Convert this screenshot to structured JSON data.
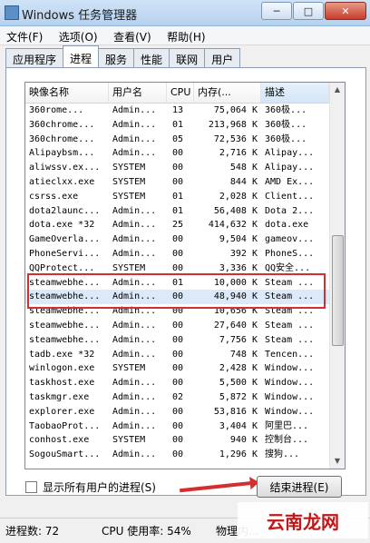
{
  "window": {
    "title": "Windows 任务管理器",
    "minimize": "─",
    "maximize": "□",
    "close": "✕"
  },
  "menu": [
    "文件(F)",
    "选项(O)",
    "查看(V)",
    "帮助(H)"
  ],
  "tabs": [
    "应用程序",
    "进程",
    "服务",
    "性能",
    "联网",
    "用户"
  ],
  "columns": {
    "name": "映像名称",
    "user": "用户名",
    "cpu": "CPU",
    "mem": "内存(...",
    "desc": "描述"
  },
  "processes": [
    {
      "name": "360rome...",
      "user": "Admin...",
      "cpu": "13",
      "mem": "75,064 K",
      "desc": "360极..."
    },
    {
      "name": "360chrome...",
      "user": "Admin...",
      "cpu": "01",
      "mem": "213,968 K",
      "desc": "360极..."
    },
    {
      "name": "360chrome...",
      "user": "Admin...",
      "cpu": "05",
      "mem": "72,536 K",
      "desc": "360极..."
    },
    {
      "name": "Alipaybsm...",
      "user": "Admin...",
      "cpu": "00",
      "mem": "2,716 K",
      "desc": "Alipay..."
    },
    {
      "name": "aliwssv.ex...",
      "user": "SYSTEM",
      "cpu": "00",
      "mem": "548 K",
      "desc": "Alipay..."
    },
    {
      "name": "atieclxx.exe",
      "user": "SYSTEM",
      "cpu": "00",
      "mem": "844 K",
      "desc": "AMD Ex..."
    },
    {
      "name": "csrss.exe",
      "user": "SYSTEM",
      "cpu": "01",
      "mem": "2,028 K",
      "desc": "Client..."
    },
    {
      "name": "dota2launc...",
      "user": "Admin...",
      "cpu": "01",
      "mem": "56,408 K",
      "desc": "Dota 2..."
    },
    {
      "name": "dota.exe *32",
      "user": "Admin...",
      "cpu": "25",
      "mem": "414,632 K",
      "desc": "dota.exe"
    },
    {
      "name": "GameOverla...",
      "user": "Admin...",
      "cpu": "00",
      "mem": "9,504 K",
      "desc": "gameov..."
    },
    {
      "name": "PhoneServi...",
      "user": "Admin...",
      "cpu": "00",
      "mem": "392 K",
      "desc": "PhoneS..."
    },
    {
      "name": "QQProtect...",
      "user": "SYSTEM",
      "cpu": "00",
      "mem": "3,336 K",
      "desc": "QQ安全..."
    },
    {
      "name": "steamwebhe...",
      "user": "Admin...",
      "cpu": "01",
      "mem": "10,000 K",
      "desc": "Steam ..."
    },
    {
      "name": "steamwebhe...",
      "user": "Admin...",
      "cpu": "00",
      "mem": "48,940 K",
      "desc": "Steam ..."
    },
    {
      "name": "steamwebhe...",
      "user": "Admin...",
      "cpu": "00",
      "mem": "10,656 K",
      "desc": "Steam ..."
    },
    {
      "name": "steamwebhe...",
      "user": "Admin...",
      "cpu": "00",
      "mem": "27,640 K",
      "desc": "Steam ..."
    },
    {
      "name": "steamwebhe...",
      "user": "Admin...",
      "cpu": "00",
      "mem": "7,756 K",
      "desc": "Steam ..."
    },
    {
      "name": "tadb.exe *32",
      "user": "Admin...",
      "cpu": "00",
      "mem": "748 K",
      "desc": "Tencen..."
    },
    {
      "name": "winlogon.exe",
      "user": "SYSTEM",
      "cpu": "00",
      "mem": "2,428 K",
      "desc": "Window..."
    },
    {
      "name": "taskhost.exe",
      "user": "Admin...",
      "cpu": "00",
      "mem": "5,500 K",
      "desc": "Window..."
    },
    {
      "name": "taskmgr.exe",
      "user": "Admin...",
      "cpu": "02",
      "mem": "5,872 K",
      "desc": "Window..."
    },
    {
      "name": "explorer.exe",
      "user": "Admin...",
      "cpu": "00",
      "mem": "53,816 K",
      "desc": "Window..."
    },
    {
      "name": "TaobaoProt...",
      "user": "Admin...",
      "cpu": "00",
      "mem": "3,404 K",
      "desc": "阿里巴..."
    },
    {
      "name": "conhost.exe",
      "user": "SYSTEM",
      "cpu": "00",
      "mem": "940 K",
      "desc": "控制台..."
    },
    {
      "name": "SogouSmart...",
      "user": "Admin...",
      "cpu": "00",
      "mem": "1,296 K",
      "desc": "搜狗..."
    }
  ],
  "selected_row": 13,
  "show_all_label": "显示所有用户的进程(S)",
  "end_process_label": "结束进程(E)",
  "status": {
    "processes": "进程数: 72",
    "cpu": "CPU 使用率: 54%",
    "memory": "物理内..."
  },
  "watermark": "云南龙网",
  "colors": {
    "highlight": "#d23030",
    "selected": "#dbe9f8"
  }
}
